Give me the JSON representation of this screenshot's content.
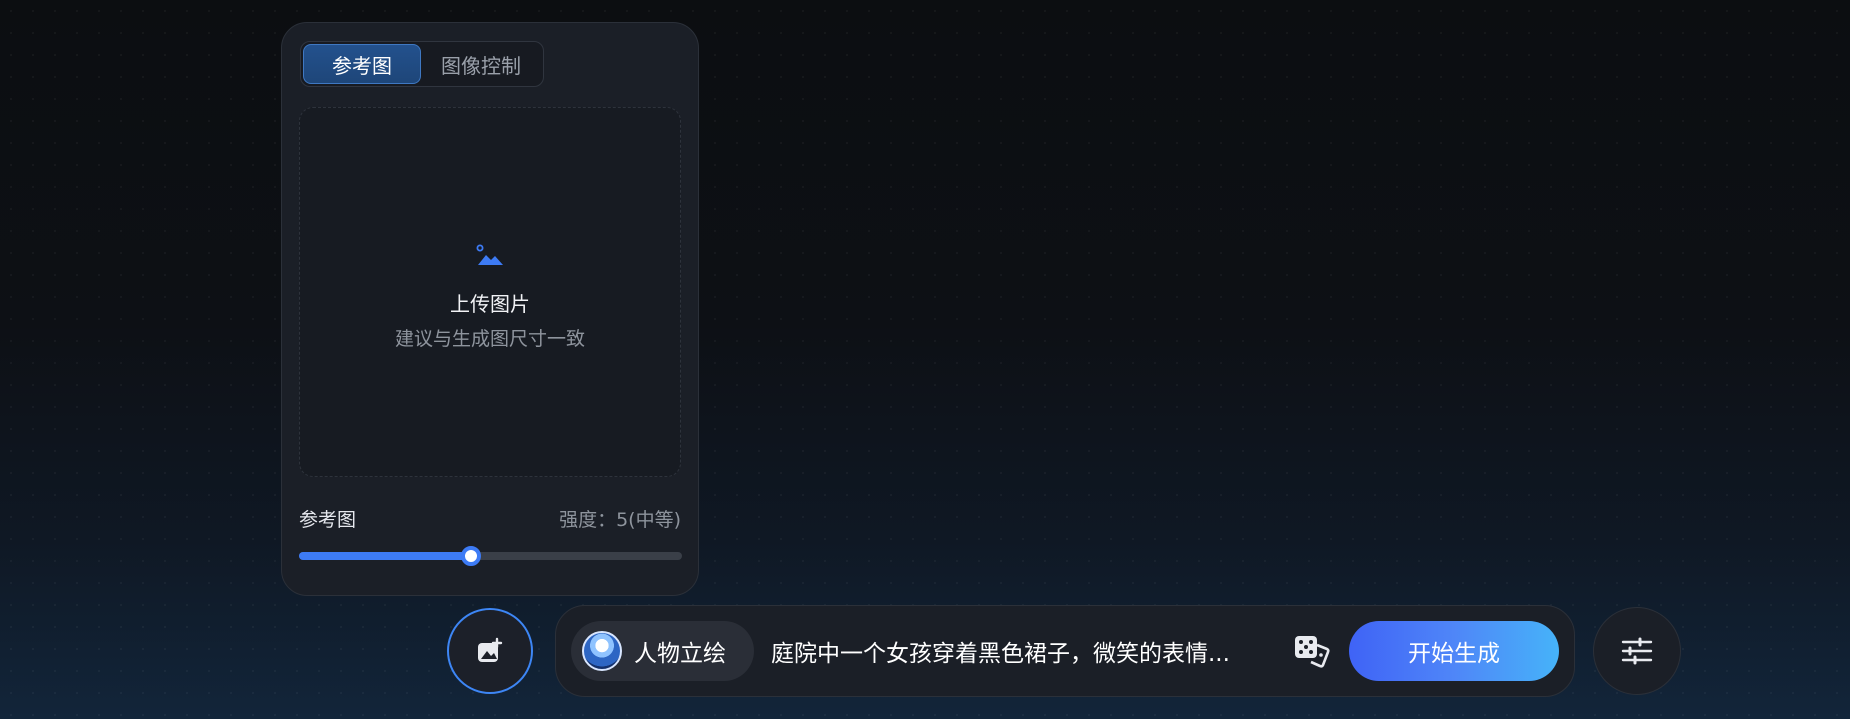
{
  "reference_panel": {
    "tabs": [
      {
        "label": "参考图",
        "active": true
      },
      {
        "label": "图像控制",
        "active": false
      }
    ],
    "upload": {
      "icon": "image-icon",
      "title": "上传图片",
      "hint": "建议与生成图尺寸一致"
    },
    "strength": {
      "label": "参考图",
      "value_text": "强度：5(中等)",
      "fraction": 0.45
    }
  },
  "bottom_bar": {
    "add_image_icon": "image-add-icon",
    "style_chip": {
      "label": "人物立绘",
      "avatar": "character-avatar"
    },
    "prompt": "庭院中一个女孩穿着黑色裙子，微笑的表情...",
    "random_icon": "dice-icon",
    "generate_label": "开始生成",
    "settings_icon": "sliders-icon"
  },
  "colors": {
    "accent": "#3d7bf5",
    "panel": "#1b1f27",
    "generate_gradient_start": "#3f63f6",
    "generate_gradient_end": "#46b3f9"
  }
}
